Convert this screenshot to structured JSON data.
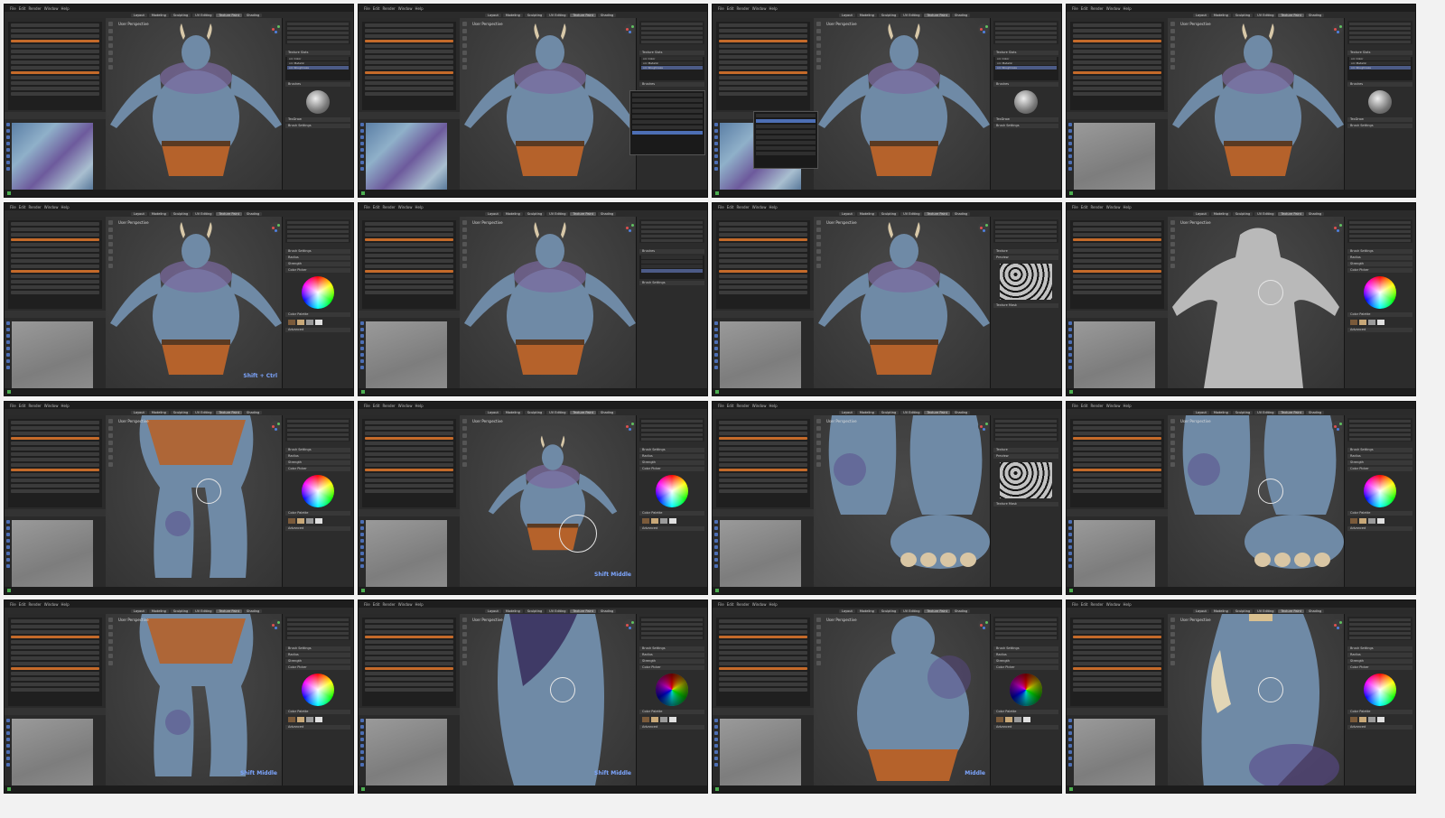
{
  "app": {
    "menu": [
      "File",
      "Edit",
      "Render",
      "Window",
      "Help"
    ],
    "workspace_tabs": [
      "Layout",
      "Modeling",
      "Sculpting",
      "UV Editing",
      "Texture Paint",
      "Shading",
      "Animation",
      "Rendering",
      "Compositing",
      "Scripting"
    ],
    "active_tab": "Texture Paint",
    "viewport_label": "User Perspective",
    "brush_name": "TexDraw"
  },
  "panels": {
    "texture_slots": "Texture Slots",
    "brushes": "Brushes",
    "brush_settings": "Brush Settings",
    "color_picker": "Color Picker",
    "color_palette": "Color Palette",
    "advanced": "Advanced",
    "texture": "Texture",
    "texture_mask": "Texture Mask",
    "preview": "Preview",
    "radius": "Radius",
    "strength": "Strength",
    "blend": "Blend",
    "palette": "Palette"
  },
  "slots": [
    "orc Color",
    "orc Metallic",
    "orc Roughness"
  ],
  "overlay_labels": [
    "Shift + Ctrl",
    "Shift Middle",
    "Shift Middle",
    "Middle"
  ],
  "colors": {
    "accent": "#4d6fb5",
    "active_orange": "#c46a2a",
    "skin": "#6f8aa6",
    "spots": "#5a4a8c",
    "loincloth": "#b5622b",
    "viewport_bg": "#3c3c3c"
  },
  "icons": {
    "add": "add-icon",
    "remove": "remove-icon",
    "eye": "eye-icon",
    "brush": "brush-icon",
    "eyedropper": "eyedropper-icon",
    "zoom": "zoom-icon"
  }
}
